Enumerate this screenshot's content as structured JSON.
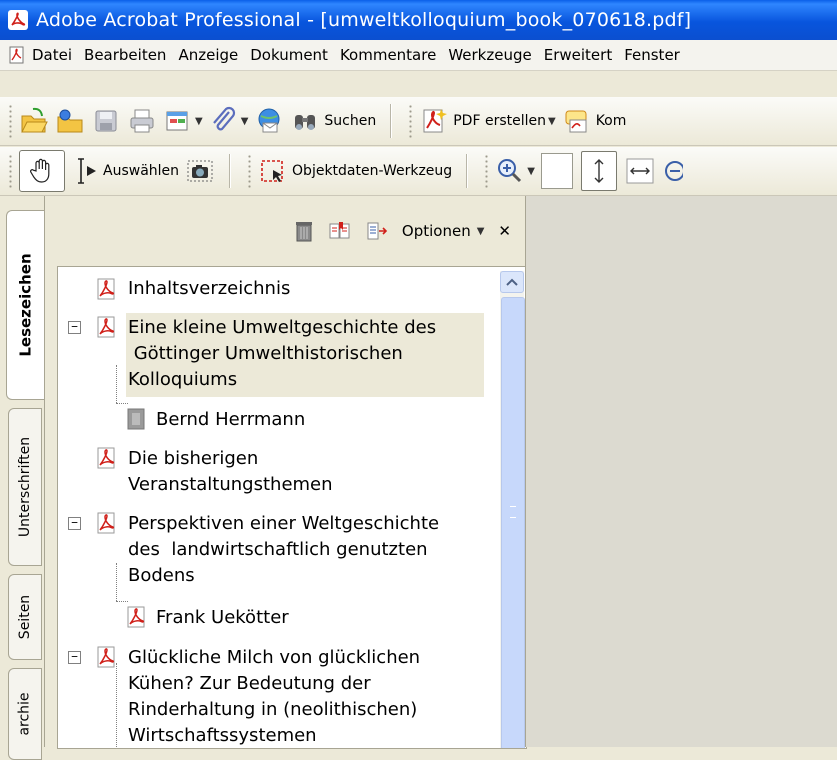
{
  "window": {
    "title": "Adobe Acrobat Professional - [umweltkolloquium_book_070618.pdf]"
  },
  "menu": [
    "Datei",
    "Bearbeiten",
    "Anzeige",
    "Dokument",
    "Kommentare",
    "Werkzeuge",
    "Erweitert",
    "Fenster"
  ],
  "toolbar1": {
    "search_label": "Suchen",
    "create_pdf_label": "PDF erstellen",
    "truncated_label": "Kom"
  },
  "toolbar2": {
    "select_label": "Auswählen",
    "object_data_label": "Objektdaten-Werkzeug"
  },
  "panel": {
    "options_label": "Optionen"
  },
  "tabs": [
    "Lesezeichen",
    "Unterschriften",
    "Seiten",
    "archie"
  ],
  "bookmarks": [
    {
      "lines": [
        "Inhaltsverzeichnis"
      ]
    },
    {
      "lines": [
        "Eine kleine Umweltgeschichte des",
        " Göttinger Umwelthistorischen",
        "Kolloquiums"
      ]
    },
    {
      "lines": [
        "Bernd Herrmann"
      ]
    },
    {
      "lines": [
        "Die bisherigen",
        "Veranstaltungsthemen"
      ]
    },
    {
      "lines": [
        "Perspektiven einer Weltgeschichte",
        "des  landwirtschaftlich genutzten",
        "Bodens"
      ]
    },
    {
      "lines": [
        "Frank Uekötter"
      ]
    },
    {
      "lines": [
        "Glückliche Milch von glücklichen",
        "Kühen? Zur Bedeutung der",
        "Rinderhaltung in (neolithischen)",
        "Wirtschaftssystemen"
      ]
    }
  ],
  "colors": {
    "titlebar": "#0855dd",
    "selection": "#ece9d8",
    "pdf_red": "#d0201a"
  }
}
